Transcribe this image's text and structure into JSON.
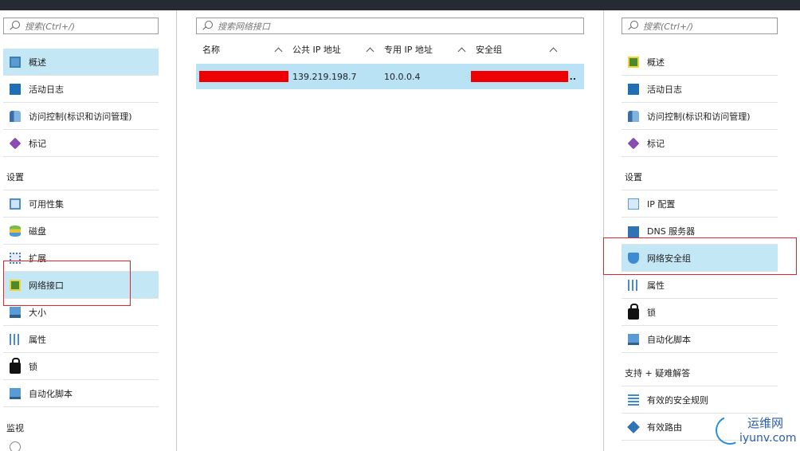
{
  "left_panel": {
    "search_placeholder": "搜索(Ctrl+/)",
    "items_top": [
      {
        "label": "概述",
        "icon": "overview-icon"
      },
      {
        "label": "活动日志",
        "icon": "activity-log-icon"
      },
      {
        "label": "访问控制(标识和访问管理)",
        "icon": "access-control-icon"
      },
      {
        "label": "标记",
        "icon": "tag-icon"
      }
    ],
    "settings_header": "设置",
    "items_settings": [
      {
        "label": "可用性集",
        "icon": "availability-set-icon"
      },
      {
        "label": "磁盘",
        "icon": "disk-icon"
      },
      {
        "label": "扩展",
        "icon": "extensions-icon"
      },
      {
        "label": "网络接口",
        "icon": "network-interface-icon"
      },
      {
        "label": "大小",
        "icon": "size-icon"
      },
      {
        "label": "属性",
        "icon": "properties-icon"
      },
      {
        "label": "锁",
        "icon": "lock-icon"
      },
      {
        "label": "自动化脚本",
        "icon": "automation-script-icon"
      }
    ],
    "monitor_header": "监视"
  },
  "middle_panel": {
    "search_placeholder": "搜索网络接口",
    "columns": [
      "名称",
      "公共 IP 地址",
      "专用 IP 地址",
      "安全组"
    ],
    "rows": [
      {
        "name": "",
        "public_ip": "139.219.198.7",
        "private_ip": "10.0.0.4",
        "security_group": "..",
        "name_redacted": true,
        "security_group_redacted": true
      }
    ]
  },
  "right_panel": {
    "search_placeholder": "搜索(Ctrl+/)",
    "items_top": [
      {
        "label": "概述",
        "icon": "overview-icon"
      },
      {
        "label": "活动日志",
        "icon": "activity-log-icon"
      },
      {
        "label": "访问控制(标识和访问管理)",
        "icon": "access-control-icon"
      },
      {
        "label": "标记",
        "icon": "tag-icon"
      }
    ],
    "settings_header": "设置",
    "items_settings": [
      {
        "label": "IP 配置",
        "icon": "ip-config-icon"
      },
      {
        "label": "DNS 服务器",
        "icon": "dns-server-icon"
      },
      {
        "label": "网络安全组",
        "icon": "network-security-group-icon"
      },
      {
        "label": "属性",
        "icon": "properties-icon"
      },
      {
        "label": "锁",
        "icon": "lock-icon"
      },
      {
        "label": "自动化脚本",
        "icon": "automation-script-icon"
      }
    ],
    "support_header": "支持 + 疑难解答",
    "items_support": [
      {
        "label": "有效的安全规则",
        "icon": "security-rules-icon"
      },
      {
        "label": "有效路由",
        "icon": "routes-icon"
      }
    ]
  },
  "watermark": {
    "cn": "运维网",
    "en": "iyunv.com"
  },
  "colors": {
    "selected": "#c4e7f5",
    "row_selected": "#b9e2f4",
    "highlight_box": "#e0252b",
    "redaction": "#ee0000"
  }
}
